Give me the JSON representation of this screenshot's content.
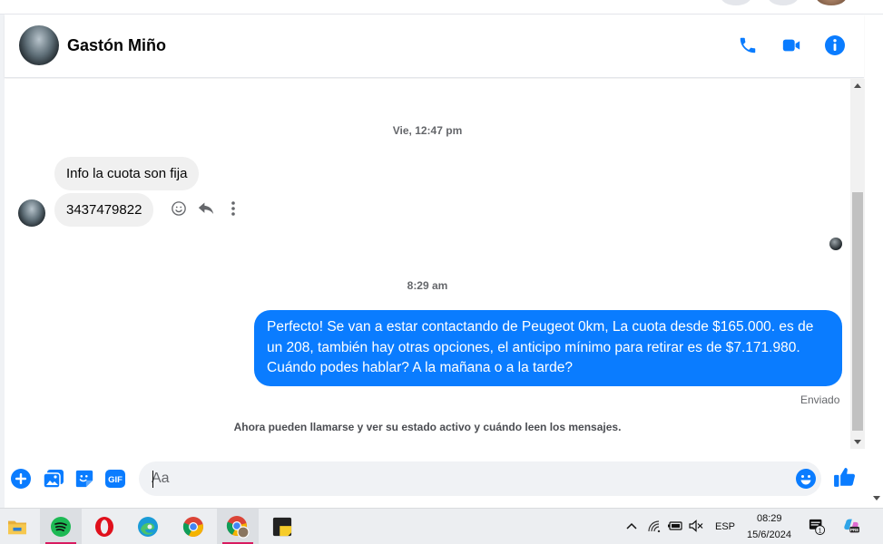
{
  "colors": {
    "accent": "#0a7cff",
    "incoming_bubble": "#f0f0f0",
    "taskbar": "#eceef1"
  },
  "header": {
    "contact_name": "Gastón Miño",
    "icons": [
      "phone-icon",
      "video-camera-icon",
      "info-icon"
    ]
  },
  "messages": {
    "timestamp_1": "Vie, 12:47 pm",
    "incoming": [
      {
        "text": "Info la cuota son fija"
      },
      {
        "text": "3437479822"
      }
    ],
    "message_actions": [
      "smiley-react-icon",
      "reply-icon",
      "more-vertical-icon"
    ],
    "timestamp_2": "8:29 am",
    "outgoing": {
      "text": "Perfecto!  Se van a estar contactando de Peugeot 0km, La cuota desde $165.000. es de un 208, también hay otras opciones, el anticipo mínimo para retirar es de $7.171.980. Cuándo podes hablar? A la mañana o a la tarde?"
    },
    "sent_status": "Enviado",
    "info_line": "Ahora pueden llamarse y ver su estado activo y cuándo leen los mensajes."
  },
  "composer": {
    "placeholder": "Aa",
    "icons": [
      "plus-circle-icon",
      "image-icon",
      "sticker-icon",
      "gif-icon",
      "emoji-icon",
      "thumbs-up-icon"
    ],
    "gif_label": "GIF"
  },
  "taskbar": {
    "apps": [
      "file-explorer-icon",
      "spotify-icon",
      "opera-icon",
      "edge-icon",
      "chrome-icon",
      "chrome-profile-icon",
      "sticky-notes-icon"
    ],
    "active_app": "chrome-profile-icon",
    "language": "ESP",
    "time": "08:29",
    "date": "15/6/2024",
    "notification_count": "1",
    "tray_icons": [
      "chevron-up-icon",
      "wifi-icon",
      "battery-icon",
      "mute-icon",
      "notification-icon",
      "copilot-icon"
    ],
    "copilot_badge": "PRE"
  }
}
